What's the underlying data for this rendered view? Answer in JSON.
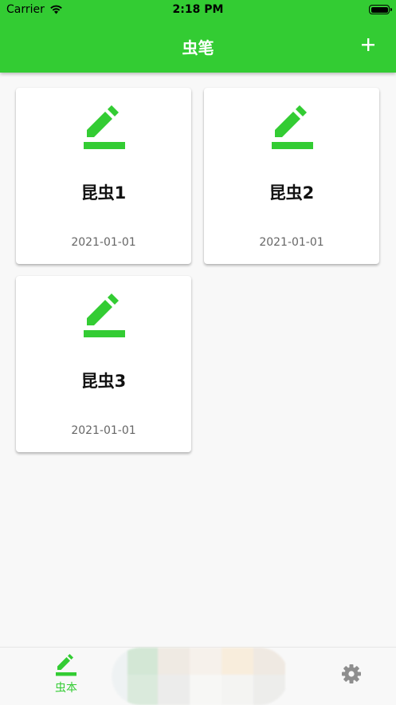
{
  "status": {
    "carrier": "Carrier",
    "time": "2:18 PM"
  },
  "nav": {
    "title": "虫笔",
    "add_label": "+"
  },
  "cards": [
    {
      "name": "昆虫1",
      "date": "2021-01-01"
    },
    {
      "name": "昆虫2",
      "date": "2021-01-01"
    },
    {
      "name": "昆虫3",
      "date": "2021-01-01"
    }
  ],
  "tabbar": {
    "notes_label": "虫本"
  },
  "colors": {
    "accent": "#33cc33",
    "background": "#f8f8f8"
  },
  "icons": {
    "card": "pencil-edit-icon",
    "add": "plus-icon",
    "tab_notes": "pencil-edit-icon",
    "tab_settings": "gear-icon"
  }
}
